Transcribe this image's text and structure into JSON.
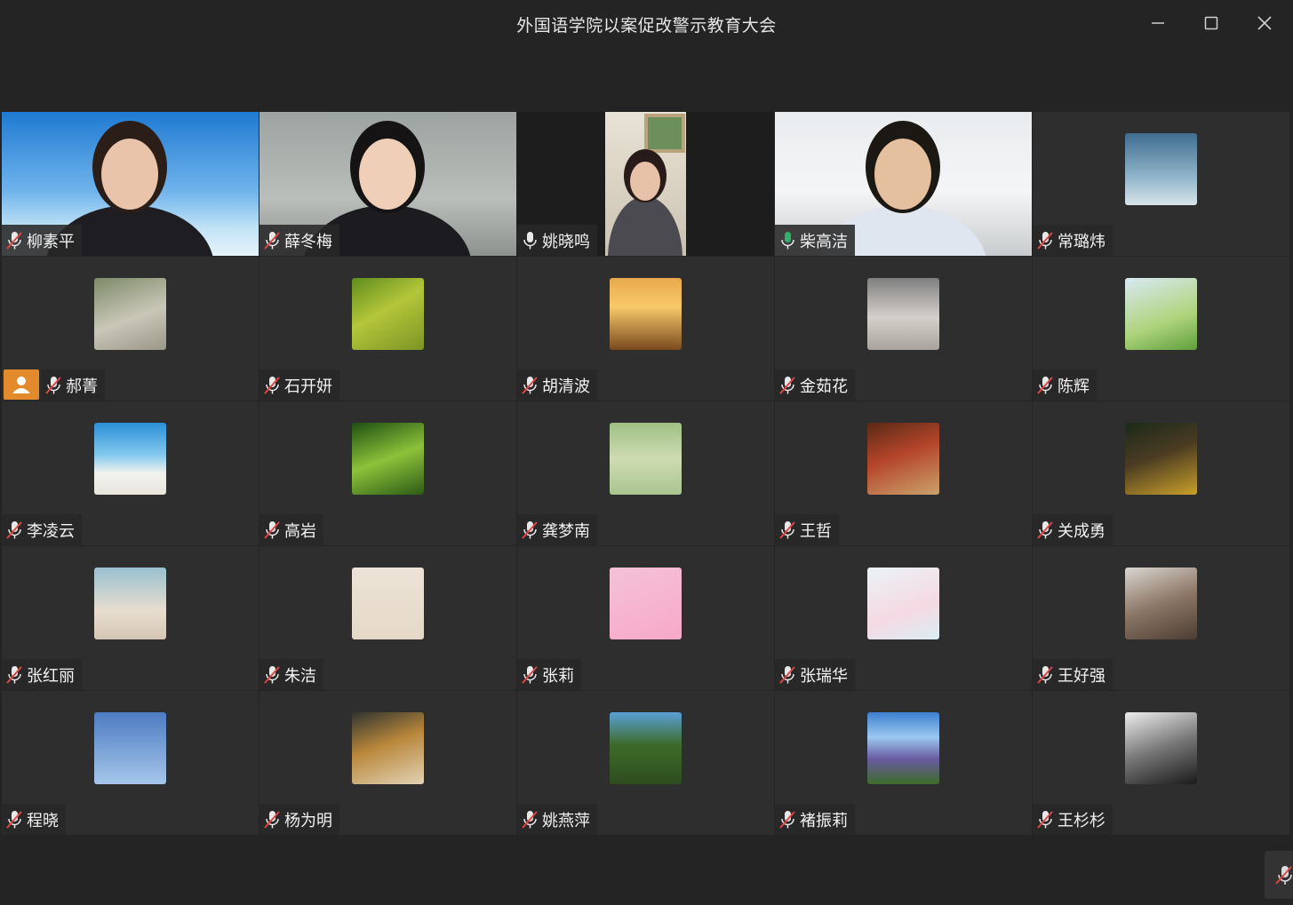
{
  "window": {
    "title": "外国语学院以案促改警示教育大会"
  },
  "colors": {
    "background": "#242424",
    "tile": "#2e2e2e",
    "active_speaker": "#2fb36b",
    "host_badge": "#e38b2c",
    "muted_red": "#e04545"
  },
  "participants": [
    {
      "name": "柳素平",
      "mic": "muted",
      "kind": "video"
    },
    {
      "name": "薛冬梅",
      "mic": "muted",
      "kind": "video"
    },
    {
      "name": "姚晓鸣",
      "mic": "on",
      "kind": "video"
    },
    {
      "name": "柴高洁",
      "mic": "speaking",
      "kind": "video",
      "active": true
    },
    {
      "name": "常璐炜",
      "mic": "muted",
      "kind": "avatar"
    },
    {
      "name": "郝菁",
      "mic": "muted",
      "kind": "avatar",
      "host": true
    },
    {
      "name": "石开妍",
      "mic": "muted",
      "kind": "avatar"
    },
    {
      "name": "胡清波",
      "mic": "muted",
      "kind": "avatar"
    },
    {
      "name": "金茹花",
      "mic": "muted",
      "kind": "avatar"
    },
    {
      "name": "陈辉",
      "mic": "muted",
      "kind": "avatar"
    },
    {
      "name": "李凌云",
      "mic": "muted",
      "kind": "avatar"
    },
    {
      "name": "高岩",
      "mic": "muted",
      "kind": "avatar"
    },
    {
      "name": "龚梦南",
      "mic": "muted",
      "kind": "avatar"
    },
    {
      "name": "王哲",
      "mic": "muted",
      "kind": "avatar"
    },
    {
      "name": "关成勇",
      "mic": "muted",
      "kind": "avatar"
    },
    {
      "name": "张红丽",
      "mic": "muted",
      "kind": "avatar"
    },
    {
      "name": "朱洁",
      "mic": "muted",
      "kind": "avatar"
    },
    {
      "name": "张莉",
      "mic": "muted",
      "kind": "avatar"
    },
    {
      "name": "张瑞华",
      "mic": "muted",
      "kind": "avatar"
    },
    {
      "name": "王好强",
      "mic": "muted",
      "kind": "avatar"
    },
    {
      "name": "程晓",
      "mic": "muted",
      "kind": "avatar"
    },
    {
      "name": "杨为明",
      "mic": "muted",
      "kind": "avatar"
    },
    {
      "name": "姚燕萍",
      "mic": "muted",
      "kind": "avatar"
    },
    {
      "name": "褚振莉",
      "mic": "muted",
      "kind": "avatar"
    },
    {
      "name": "王杉杉",
      "mic": "muted",
      "kind": "avatar"
    }
  ]
}
